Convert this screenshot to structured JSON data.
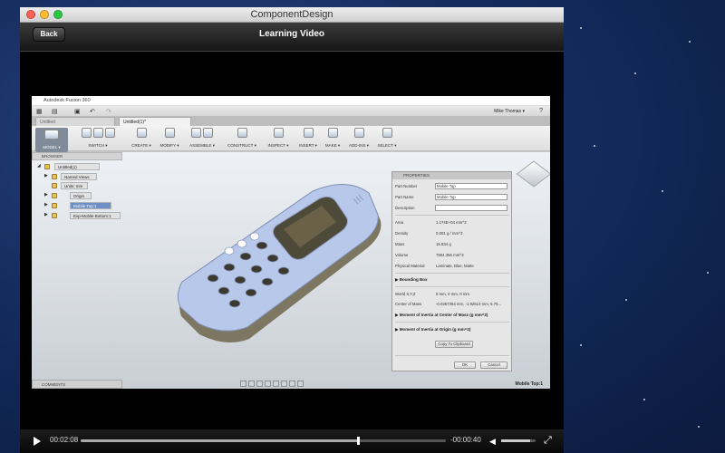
{
  "window": {
    "title": "ComponentDesign"
  },
  "nav": {
    "back_label": "Back",
    "title": "Learning Video"
  },
  "player": {
    "elapsed": "00:02:08",
    "remaining": "-00:00:40",
    "progress": 0.76,
    "volume": 0.85
  },
  "app": {
    "title": "Autodesk Fusion 360",
    "user": "Mike Thomas ▾",
    "tabs": [
      "Untitled",
      "Untitled(1)*"
    ],
    "toolbar": [
      {
        "label": "MODEL ▾"
      },
      {
        "label": "SWITCH ▾"
      },
      {
        "label": "CREATE ▾"
      },
      {
        "label": "MODIFY ▾"
      },
      {
        "label": "ASSEMBLE ▾"
      },
      {
        "label": "CONSTRUCT ▾"
      },
      {
        "label": "INSPECT ▾"
      },
      {
        "label": "INSERT ▾"
      },
      {
        "label": "MAKE ▾"
      },
      {
        "label": "ADD-INS ▾"
      },
      {
        "label": "SELECT ▾"
      }
    ],
    "browser": {
      "title": "BROWSER",
      "root": "Untitled(1)",
      "items": [
        "Named Views",
        "Units: mm",
        "Origin",
        "Mobile Top:1",
        "Exp-Mobile Bottom:1"
      ]
    },
    "comments_label": "COMMENTS",
    "component_label": "Mobile Top:1",
    "properties": {
      "title": "PROPERTIES",
      "part_number_label": "Part Number",
      "part_number": "Mobile Top",
      "part_name_label": "Part Name",
      "part_name": "Mobile Top",
      "description_label": "Description",
      "description": "",
      "area_label": "Area",
      "area": "1.174E+04 mm^2",
      "density_label": "Density",
      "density": "0.001 g / mm^3",
      "mass_label": "Mass",
      "mass": "15.834 g",
      "volume_label": "Volume",
      "volume": "7904.356 mm^3",
      "material_label": "Physical Material",
      "material": "Laminate, Blue, Matte",
      "bounding_box": "Bounding Box",
      "world_label": "World X,Y,Z",
      "world": "0 mm, 0 mm, 0 mm",
      "com_label": "Center of Mass",
      "com": "-0.0367354 mm, -1.92513 mm, 5.76...",
      "moi_com": "Moment of Inertia at Center of Mass   (g mm^2)",
      "moi_origin": "Moment of Inertia at Origin   (g mm^2)",
      "copy_label": "Copy To Clipboard",
      "ok_label": "OK",
      "cancel_label": "Cancel"
    }
  },
  "colors": {
    "desktop": "#142c5f",
    "accent_selected": "#6d8fc5",
    "phone_body": "#b7c8ea"
  }
}
